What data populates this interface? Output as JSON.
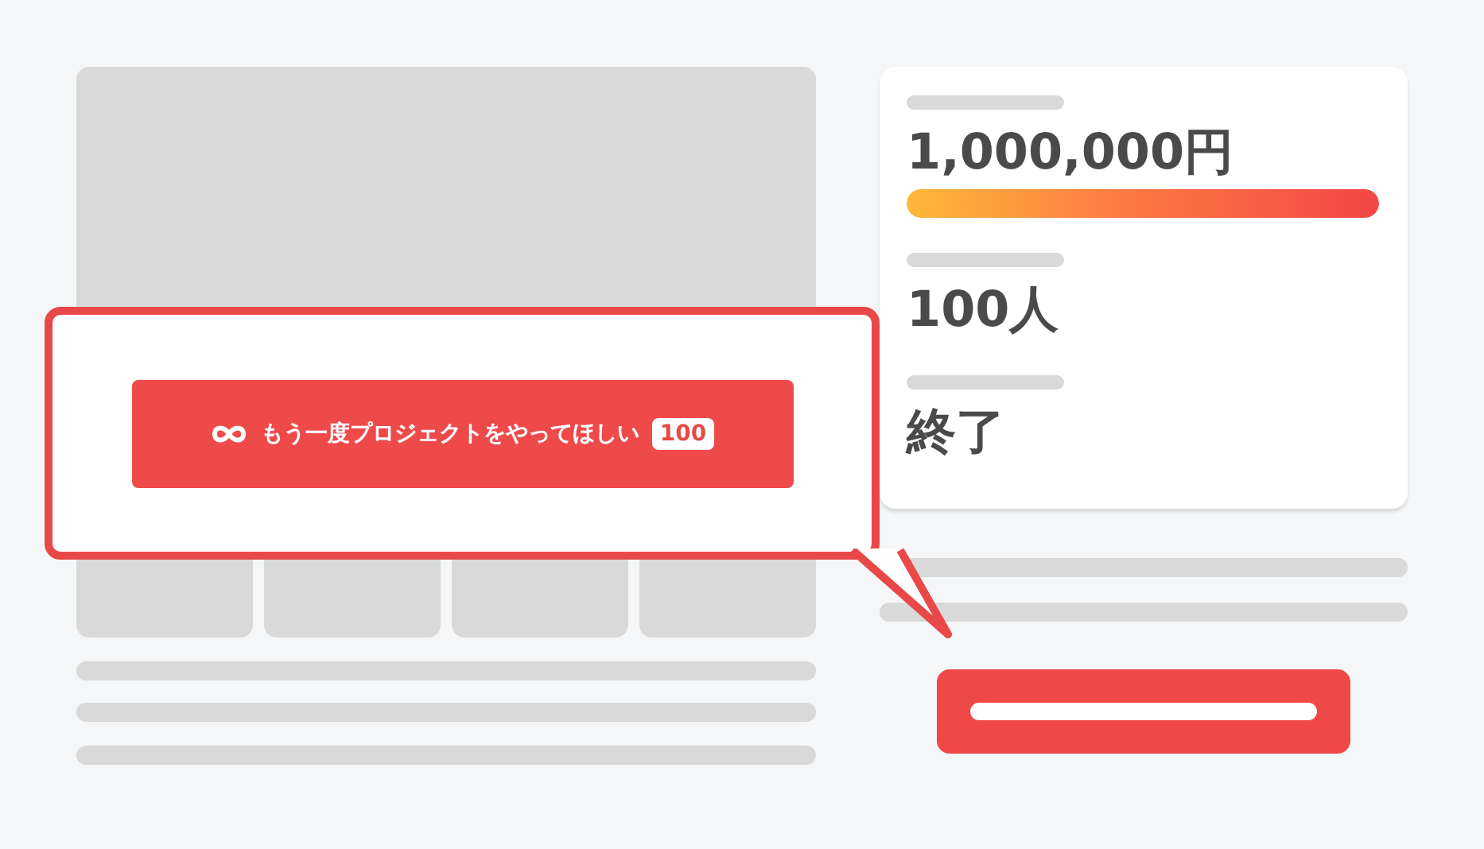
{
  "stats": [
    {
      "kind": "amount",
      "value": "1,000,000円",
      "level": 1
    },
    {
      "kind": "count",
      "value": "100人"
    },
    {
      "kind": "status",
      "value": "終了"
    }
  ],
  "callout": {
    "button": {
      "label": "もう一度プロジェクトをやってほしい",
      "count": "100"
    }
  }
}
